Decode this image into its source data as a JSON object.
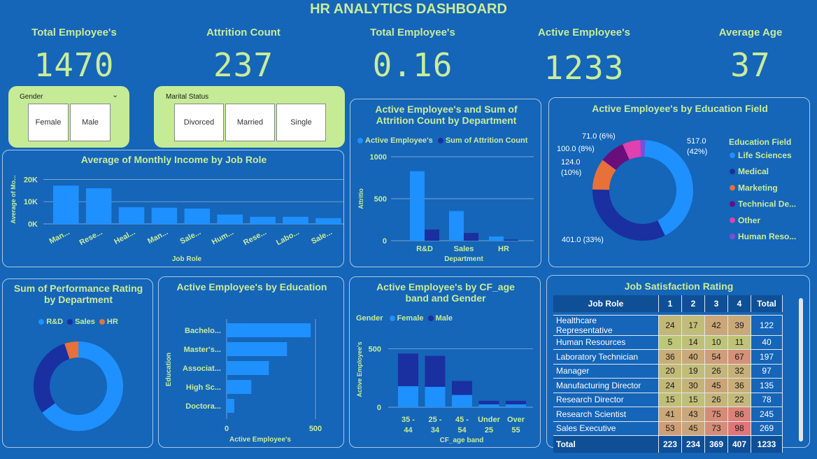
{
  "title": "HR ANALYTICS DASHBOARD",
  "kpis": [
    {
      "label": "Total Employee's",
      "value": "1470"
    },
    {
      "label": "Attrition Count",
      "value": "237"
    },
    {
      "label": "Total Employee's",
      "value": "0.16"
    },
    {
      "label": "Active Employee's",
      "value": "1233"
    },
    {
      "label": "Average Age",
      "value": "37"
    }
  ],
  "slicers": {
    "gender": {
      "label": "Gender",
      "options": [
        "Female",
        "Male"
      ]
    },
    "marital": {
      "label": "Marital Status",
      "options": [
        "Divorced",
        "Married",
        "Single"
      ]
    }
  },
  "colors": {
    "background": "#1565b8",
    "accent": "#c9ec9a",
    "light_blue": "#1e90ff",
    "dark_blue": "#1a2fa0",
    "orange": "#e8703a",
    "purple": "#6a0e7c",
    "pink": "#e040b0",
    "violet": "#7b4fd6"
  },
  "chart_data": [
    {
      "id": "income_by_role",
      "type": "bar",
      "title": "Average of Monthly Income by Job Role",
      "xlabel": "Job Role",
      "ylabel": "Average of Mo...",
      "yticks": [
        "20K",
        "10K",
        "0K"
      ],
      "ylim": [
        0,
        22000
      ],
      "categories": [
        "Man...",
        "Rese...",
        "Heal...",
        "Man...",
        "Sale...",
        "Hum...",
        "Rese...",
        "Labo...",
        "Sale..."
      ],
      "values": [
        17200,
        16000,
        7500,
        7300,
        6900,
        4200,
        3200,
        3200,
        2600
      ]
    },
    {
      "id": "dept_attrition",
      "type": "bar",
      "title": "Active Employee's and Sum of Attrition Count by Department",
      "xlabel": "Department",
      "ylabel": "Attritio",
      "yticks": [
        "1000",
        "500",
        "0"
      ],
      "ylim": [
        0,
        1000
      ],
      "categories": [
        "R&D",
        "Sales",
        "HR"
      ],
      "series": [
        {
          "name": "Active Employee's",
          "values": [
            828,
            354,
            51
          ]
        },
        {
          "name": "Sum of Attrition Count",
          "values": [
            133,
            92,
            12
          ]
        }
      ]
    },
    {
      "id": "education_field",
      "type": "pie",
      "title": "Active Employee's by Education Field",
      "legend_title": "Education Field",
      "labels": [
        "Life Sciences",
        "Medical",
        "Marketing",
        "Technical De...",
        "Other",
        "Human Reso..."
      ],
      "values": [
        517,
        401,
        124,
        100,
        71,
        20
      ],
      "data_labels": [
        "517.0 (42%)",
        "401.0 (33%)",
        "124.0 (10%)",
        "100.0 (8%)",
        "71.0 (6%)"
      ]
    },
    {
      "id": "performance_by_dept",
      "type": "pie",
      "title": "Sum of Performance Rating by Department",
      "labels": [
        "R&D",
        "Sales",
        "HR"
      ],
      "values": [
        65,
        30,
        5
      ]
    },
    {
      "id": "by_education",
      "type": "bar",
      "title": "Active Employee's by Education",
      "xlabel": "Active Employee's",
      "ylabel": "Education",
      "xticks": [
        "0",
        "500"
      ],
      "xlim": [
        0,
        500
      ],
      "categories": [
        "Bachelo...",
        "Master's...",
        "Associat...",
        "High Sc...",
        "Doctora..."
      ],
      "values": [
        473,
        340,
        238,
        139,
        43
      ]
    },
    {
      "id": "age_band_gender",
      "type": "bar",
      "title": "Active Employee's by CF_age band and Gender",
      "xlabel": "CF_age band",
      "ylabel": "Active Employee's",
      "legend_title": "Gender",
      "yticks": [
        "500",
        "0"
      ],
      "ylim": [
        0,
        600
      ],
      "categories": [
        "35 - 44",
        "25 - 34",
        "45 - 54",
        "Under 25",
        "Over 55"
      ],
      "category_lines": [
        [
          "35 -",
          "44"
        ],
        [
          "25 -",
          "34"
        ],
        [
          "45 -",
          "54"
        ],
        [
          "Under",
          "25"
        ],
        [
          "Over",
          "55"
        ]
      ],
      "series": [
        {
          "name": "Female",
          "values": [
            180,
            175,
            105,
            25,
            25
          ]
        },
        {
          "name": "Male",
          "values": [
            280,
            265,
            120,
            30,
            30
          ]
        }
      ]
    },
    {
      "id": "job_satisfaction",
      "type": "table",
      "title": "Job Satisfaction Rating",
      "columns": [
        "Job Role",
        "1",
        "2",
        "3",
        "4",
        "Total"
      ],
      "rows": [
        [
          "Healthcare Representative",
          "24",
          "17",
          "42",
          "39",
          "122"
        ],
        [
          "Human Resources",
          "5",
          "14",
          "10",
          "11",
          "40"
        ],
        [
          "Laboratory Technician",
          "36",
          "40",
          "54",
          "67",
          "197"
        ],
        [
          "Manager",
          "20",
          "19",
          "26",
          "32",
          "97"
        ],
        [
          "Manufacturing Director",
          "24",
          "30",
          "45",
          "36",
          "135"
        ],
        [
          "Research Director",
          "15",
          "15",
          "26",
          "22",
          "78"
        ],
        [
          "Research Scientist",
          "41",
          "43",
          "75",
          "86",
          "245"
        ],
        [
          "Sales Executive",
          "53",
          "45",
          "73",
          "98",
          "269"
        ]
      ],
      "total": [
        "Total",
        "223",
        "234",
        "369",
        "407",
        "1233"
      ]
    }
  ]
}
